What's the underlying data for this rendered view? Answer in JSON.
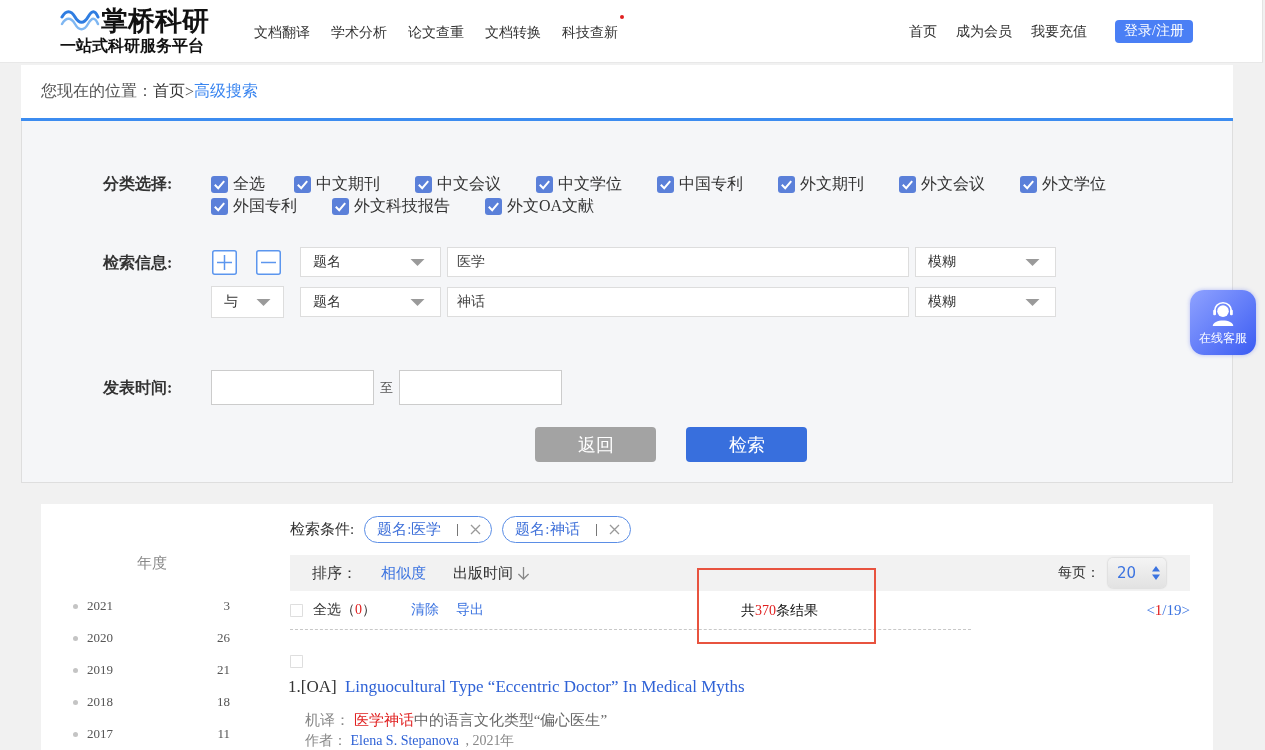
{
  "header": {
    "logo": {
      "name": "掌桥科研",
      "slogan": "一站式科研服务平台"
    },
    "nav": [
      {
        "label": "文档翻译",
        "dot": false
      },
      {
        "label": "学术分析",
        "dot": false
      },
      {
        "label": "论文查重",
        "dot": false
      },
      {
        "label": "文档转换",
        "dot": false
      },
      {
        "label": "科技查新",
        "dot": true
      }
    ],
    "user_links": [
      "首页",
      "成为会员",
      "我要充值"
    ],
    "login_button": "登录/注册"
  },
  "breadcrumb": {
    "label": "您现在的位置：",
    "separator": ">",
    "items": [
      {
        "label": "首页",
        "current": false
      },
      {
        "label": "高级搜索",
        "current": true
      }
    ]
  },
  "categories": {
    "label": "分类选择:",
    "items": [
      {
        "kind": "all",
        "label": "全选",
        "checked": true
      },
      {
        "kind": "source",
        "label": "中文期刊",
        "checked": true
      },
      {
        "kind": "source",
        "label": "中文会议",
        "checked": true
      },
      {
        "kind": "source",
        "label": "中文学位",
        "checked": true
      },
      {
        "kind": "source",
        "label": "中国专利",
        "checked": true
      },
      {
        "kind": "source",
        "label": "外文期刊",
        "checked": true
      },
      {
        "kind": "source",
        "label": "外文会议",
        "checked": true
      },
      {
        "kind": "source",
        "label": "外文学位",
        "checked": true
      },
      {
        "kind": "source",
        "label": "外国专利",
        "checked": true
      },
      {
        "kind": "source",
        "label": "外文科技报告",
        "checked": true
      },
      {
        "kind": "source",
        "label": "外文OA文献",
        "checked": true
      }
    ]
  },
  "search_info": {
    "label": "检索信息:",
    "rows": [
      {
        "field": "题名",
        "value": "医学",
        "match": "模糊"
      },
      {
        "operator": "与",
        "field": "题名",
        "value": "神话",
        "match": "模糊"
      }
    ]
  },
  "publish_date": {
    "label": "发表时间:",
    "separator": "至"
  },
  "buttons": [
    {
      "label": "返回",
      "disabled": true
    },
    {
      "label": "检索",
      "disabled": false
    }
  ],
  "support_button": {
    "label": "在线客服"
  },
  "year_facet": {
    "title": "年度",
    "items": [
      {
        "year": "2021",
        "count": "3"
      },
      {
        "year": "2020",
        "count": "26"
      },
      {
        "year": "2019",
        "count": "21"
      },
      {
        "year": "2018",
        "count": "18"
      },
      {
        "year": "2017",
        "count": "11"
      }
    ]
  },
  "results": {
    "conditions": {
      "label": "检索条件:",
      "tags": [
        "题名:医学",
        "题名:神话"
      ]
    },
    "sort": {
      "label": "排序：",
      "options": [
        {
          "label": "相似度",
          "kind": "relevance",
          "selected": true
        },
        {
          "label": "出版时间",
          "kind": "date",
          "selected": false
        }
      ]
    },
    "per_page": {
      "label": "每页：",
      "value": "20"
    },
    "select_all": {
      "checked": false,
      "segments": [
        {
          "text": "全选（",
          "highlight": false
        },
        {
          "text": "0",
          "highlight": true
        },
        {
          "text": "）",
          "highlight": false
        }
      ]
    },
    "actions": [
      "清除",
      "导出"
    ],
    "total": {
      "boxed": true,
      "segments": [
        {
          "text": "共",
          "highlight": false
        },
        {
          "text": "370",
          "highlight": true
        },
        {
          "text": "条结果",
          "highlight": false
        }
      ]
    },
    "pagination": {
      "segments": [
        {
          "text": "<",
          "highlight": false
        },
        {
          "text": "1",
          "highlight": true
        },
        {
          "text": "/19>",
          "highlight": false
        }
      ]
    },
    "items": [
      {
        "checked": false,
        "index": "1.",
        "tag": "[OA]",
        "title": "Linguocultural Type “Eccentric Doctor” In Medical Myths",
        "translation": {
          "label": "机译：",
          "segments": [
            {
              "text": "医学神话",
              "highlight": true
            },
            {
              "text": "中的语言文化类型“偏心医生”",
              "highlight": false
            }
          ]
        },
        "author": {
          "label": "作者：",
          "name": "Elena S. Stepanova",
          "date": ", 2021年"
        }
      }
    ]
  }
}
